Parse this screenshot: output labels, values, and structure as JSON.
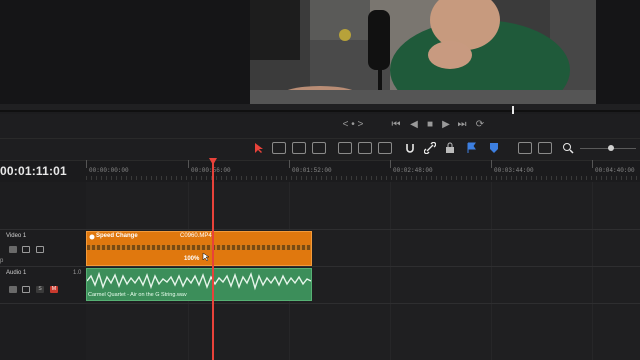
{
  "transport": {
    "jog_label": "< • >",
    "buttons": [
      "⏮",
      "◀",
      "■",
      "▶",
      "⏭",
      "⟳"
    ]
  },
  "timeline": {
    "timecode": "00:01:11:01",
    "ruler": [
      "00:00:00:00",
      "00:00:56:00",
      "00:01:52:00",
      "00:02:48:00",
      "00:03:44:00",
      "00:04:40:00"
    ]
  },
  "tracks": {
    "video": {
      "name": "Video 1",
      "extra": "p"
    },
    "audio": {
      "name": "Audio 1",
      "level": "1.0",
      "solo": "S",
      "mute": "M"
    }
  },
  "clips": {
    "video": {
      "title": "Speed Change",
      "file": "C0960.MP4",
      "speed": "100%"
    },
    "audio": {
      "label": "Carmel Quartet - Air on the G String.wav"
    }
  },
  "colors": {
    "video_clip": "#e0780e",
    "audio_clip": "#3c8e5a",
    "playhead": "#e8423a",
    "accent_blue": "#3d7fe0"
  }
}
